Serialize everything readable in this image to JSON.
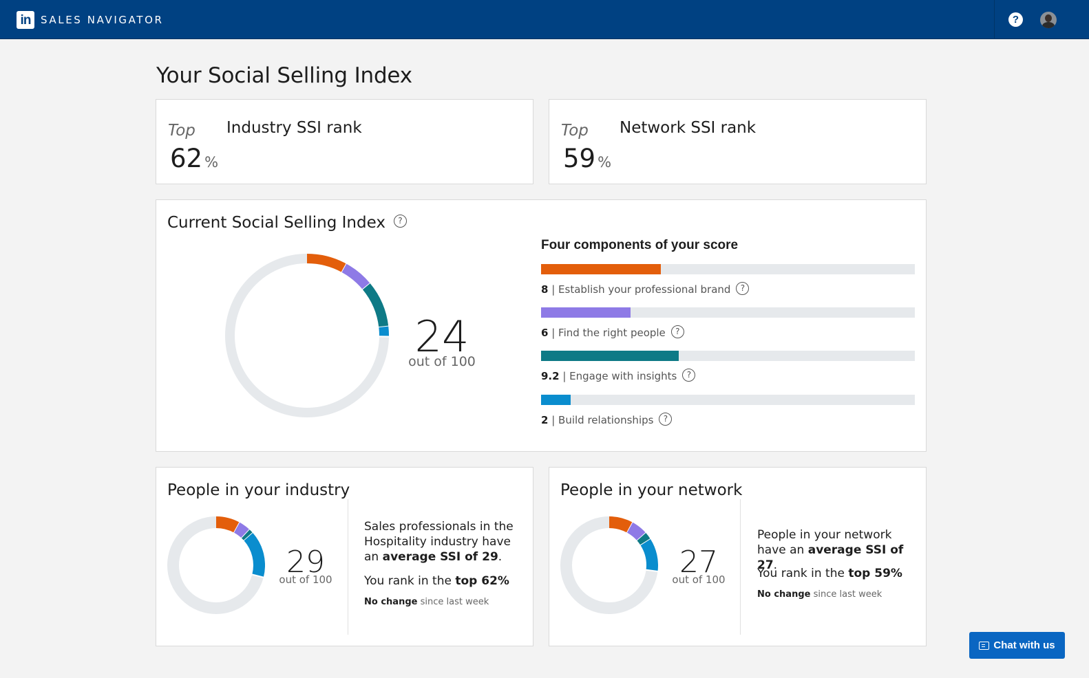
{
  "header": {
    "logo_text": "in",
    "brand": "SALES NAVIGATOR",
    "help_icon": "help-icon",
    "help_symbol": "?",
    "avatar_icon": "avatar"
  },
  "page": {
    "title": "Your Social Selling Index"
  },
  "industry_rank": {
    "top_label": "Top",
    "title": "Industry SSI rank",
    "value": "62",
    "unit": "%"
  },
  "network_rank": {
    "top_label": "Top",
    "title": "Network SSI rank",
    "value": "59",
    "unit": "%"
  },
  "current_ssi": {
    "title": "Current Social Selling Index",
    "help_symbol": "?",
    "score": "24",
    "out_of": "out of 100",
    "components_title": "Four components of your score",
    "components": [
      {
        "score": "8",
        "label": "| Establish your professional brand",
        "value": 8,
        "max": 25,
        "color": "#e35e0b"
      },
      {
        "score": "6",
        "label": "| Find the right people",
        "value": 6,
        "max": 25,
        "color": "#8e7ae6"
      },
      {
        "score": "9.2",
        "label": "| Engage with insights",
        "value": 9.2,
        "max": 25,
        "color": "#0e7a86"
      },
      {
        "score": "2",
        "label": "| Build relationships",
        "value": 2,
        "max": 25,
        "color": "#0a8dce"
      }
    ],
    "track_color": "#e6e9ec"
  },
  "industry": {
    "title": "People in your industry",
    "score": "29",
    "out_of": "out of 100",
    "blurb_1": "Sales professionals in the Hospitality industry have an ",
    "blurb_bold": "average SSI of 29",
    "blurb_end": ".",
    "rank_text": "You rank in the ",
    "rank_bold": "top 62%",
    "change_bold": "No change",
    "change_text": " since last week",
    "segments": [
      8,
      4,
      1.5,
      15.5
    ]
  },
  "network": {
    "title": "People in your network",
    "score": "27",
    "out_of": "out of 100",
    "blurb_1": "People in your network have an ",
    "blurb_bold": "average SSI of 27",
    "blurb_end": ".",
    "rank_text": "You rank in the ",
    "rank_bold": "top 59%",
    "change_bold": "No change",
    "change_text": " since last week",
    "segments": [
      8,
      5.5,
      2.5,
      11
    ]
  },
  "chat": {
    "label": "Chat with us",
    "icon": "chat-icon"
  }
}
